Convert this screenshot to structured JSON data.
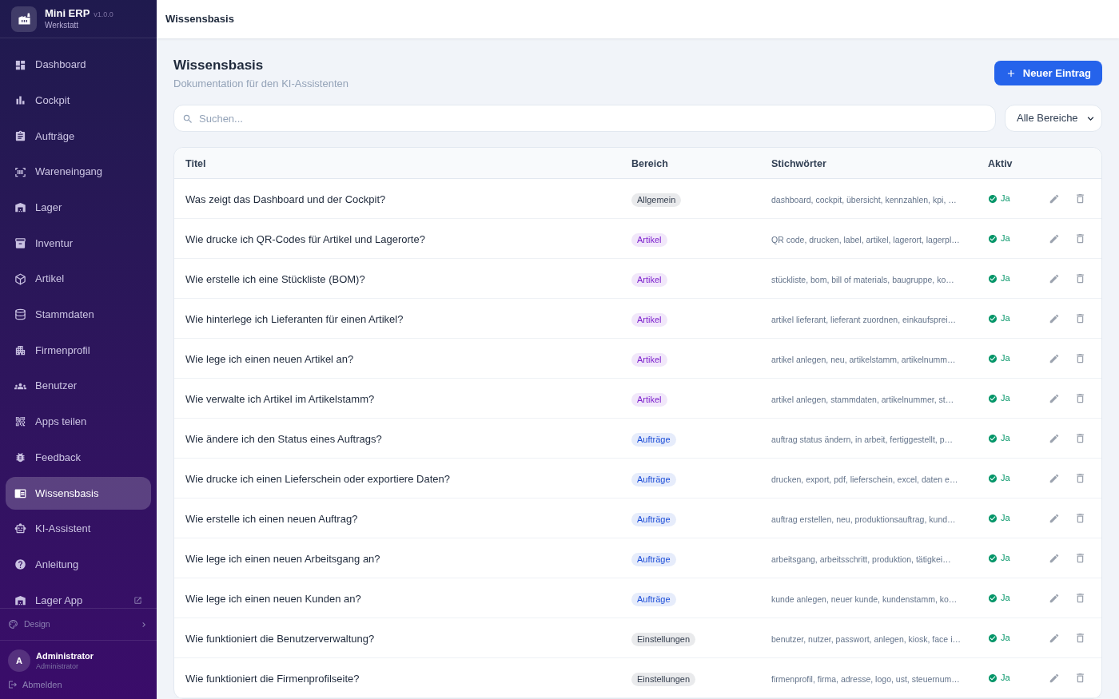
{
  "sidebar": {
    "app_name": "Mini ERP",
    "version": "v1.0.0",
    "subtitle": "Werkstatt",
    "nav_items": [
      {
        "label": "Dashboard",
        "selected": false,
        "external": false
      },
      {
        "label": "Cockpit",
        "selected": false,
        "external": false
      },
      {
        "label": "Aufträge",
        "selected": false,
        "external": false
      },
      {
        "label": "Wareneingang",
        "selected": false,
        "external": false
      },
      {
        "label": "Lager",
        "selected": false,
        "external": false
      },
      {
        "label": "Inventur",
        "selected": false,
        "external": false
      },
      {
        "label": "Artikel",
        "selected": false,
        "external": false
      },
      {
        "label": "Stammdaten",
        "selected": false,
        "external": false
      },
      {
        "label": "Firmenprofil",
        "selected": false,
        "external": false
      },
      {
        "label": "Benutzer",
        "selected": false,
        "external": false
      },
      {
        "label": "Apps teilen",
        "selected": false,
        "external": false
      },
      {
        "label": "Feedback",
        "selected": false,
        "external": false
      },
      {
        "label": "Wissensbasis",
        "selected": true,
        "external": false
      },
      {
        "label": "KI-Assistent",
        "selected": false,
        "external": false
      },
      {
        "label": "Anleitung",
        "selected": false,
        "external": false
      },
      {
        "label": "Lager App",
        "selected": false,
        "external": true
      }
    ],
    "design": {
      "label": "Design"
    },
    "user": {
      "initial": "A",
      "name": "Administrator",
      "role": "Administrator"
    },
    "logout": {
      "label": "Abmelden"
    }
  },
  "topbar": {
    "title": "Wissensbasis"
  },
  "page": {
    "title": "Wissensbasis",
    "subtitle": "Dokumentation für den KI-Assistenten",
    "new_button": "Neuer Eintrag"
  },
  "search": {
    "placeholder": "Suchen..."
  },
  "filter": {
    "value": "Alle Bereiche"
  },
  "table": {
    "columns": [
      "Titel",
      "Bereich",
      "Stichwörter",
      "Aktiv"
    ],
    "rows": [
      {
        "title": "Was zeigt das Dashboard und der Cockpit?",
        "area": {
          "label": "Allgemein",
          "color": "#374151"
        },
        "keywords": "dashboard, cockpit, übersicht, kennzahlen, kpi, …",
        "active": {
          "label": "Ja",
          "on": true
        }
      },
      {
        "title": "Wie drucke ich QR-Codes für Artikel und Lagerorte?",
        "area": {
          "label": "Artikel",
          "color": "#7e22ce"
        },
        "keywords": "QR code, drucken, label, artikel, lagerort, lagerpl…",
        "active": {
          "label": "Ja",
          "on": true
        }
      },
      {
        "title": "Wie erstelle ich eine Stückliste (BOM)?",
        "area": {
          "label": "Artikel",
          "color": "#7e22ce"
        },
        "keywords": "stückliste, bom, bill of materials, baugruppe, ko…",
        "active": {
          "label": "Ja",
          "on": true
        }
      },
      {
        "title": "Wie hinterlege ich Lieferanten für einen Artikel?",
        "area": {
          "label": "Artikel",
          "color": "#7e22ce"
        },
        "keywords": "artikel lieferant, lieferant zuordnen, einkaufsprei…",
        "active": {
          "label": "Ja",
          "on": true
        }
      },
      {
        "title": "Wie lege ich einen neuen Artikel an?",
        "area": {
          "label": "Artikel",
          "color": "#7e22ce"
        },
        "keywords": "artikel anlegen, neu, artikelstamm, artikelnumm…",
        "active": {
          "label": "Ja",
          "on": true
        }
      },
      {
        "title": "Wie verwalte ich Artikel im Artikelstamm?",
        "area": {
          "label": "Artikel",
          "color": "#7e22ce"
        },
        "keywords": "artikel anlegen, stammdaten, artikelnummer, st…",
        "active": {
          "label": "Ja",
          "on": true
        }
      },
      {
        "title": "Wie ändere ich den Status eines Auftrags?",
        "area": {
          "label": "Aufträge",
          "color": "#1d4ed8"
        },
        "keywords": "auftrag status ändern, in arbeit, fertiggestellt, p…",
        "active": {
          "label": "Ja",
          "on": true
        }
      },
      {
        "title": "Wie drucke ich einen Lieferschein oder exportiere Daten?",
        "area": {
          "label": "Aufträge",
          "color": "#1d4ed8"
        },
        "keywords": "drucken, export, pdf, lieferschein, excel, daten e…",
        "active": {
          "label": "Ja",
          "on": true
        }
      },
      {
        "title": "Wie erstelle ich einen neuen Auftrag?",
        "area": {
          "label": "Aufträge",
          "color": "#1d4ed8"
        },
        "keywords": "auftrag erstellen, neu, produktionsauftrag, kund…",
        "active": {
          "label": "Ja",
          "on": true
        }
      },
      {
        "title": "Wie lege ich einen neuen Arbeitsgang an?",
        "area": {
          "label": "Aufträge",
          "color": "#1d4ed8"
        },
        "keywords": "arbeitsgang, arbeitsschritt, produktion, tätigkei…",
        "active": {
          "label": "Ja",
          "on": true
        }
      },
      {
        "title": "Wie lege ich einen neuen Kunden an?",
        "area": {
          "label": "Aufträge",
          "color": "#1d4ed8"
        },
        "keywords": "kunde anlegen, neuer kunde, kundenstamm, ko…",
        "active": {
          "label": "Ja",
          "on": true
        }
      },
      {
        "title": "Wie funktioniert die Benutzerverwaltung?",
        "area": {
          "label": "Einstellungen",
          "color": "#374151"
        },
        "keywords": "benutzer, nutzer, passwort, anlegen, kiosk, face i…",
        "active": {
          "label": "Ja",
          "on": true
        }
      },
      {
        "title": "Wie funktioniert die Firmenprofilseite?",
        "area": {
          "label": "Einstellungen",
          "color": "#374151"
        },
        "keywords": "firmenprofil, firma, adresse, logo, ust, steuernum…",
        "active": {
          "label": "Ja",
          "on": true
        }
      }
    ]
  }
}
